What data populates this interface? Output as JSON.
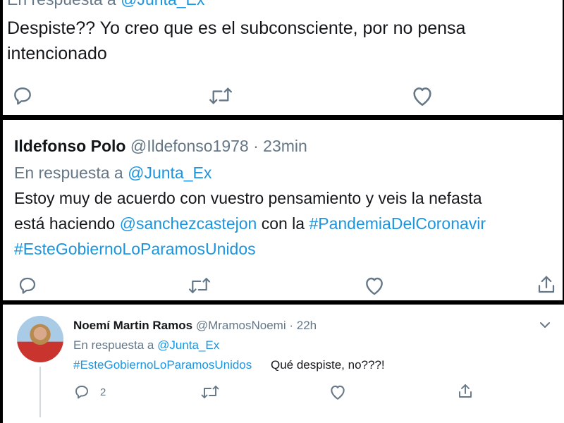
{
  "tweet1": {
    "reply_prefix": "En respuesta a",
    "reply_handle": "@Junta_Ex",
    "text_line1": "Despiste?? Yo creo que es el subconsciente, por no pensa",
    "text_line2": "intencionado"
  },
  "tweet2": {
    "name": "Ildefonso Polo",
    "handle": "@Ildefonso1978",
    "sep": "·",
    "time": "23min",
    "reply_prefix": "En respuesta a",
    "reply_handle": "@Junta_Ex",
    "line1": "Estoy muy de acuerdo con vuestro pensamiento y veis la nefasta",
    "line2_text": "está haciendo ",
    "line2_mention": "@sanchezcastejon",
    "line2_mid": " con la ",
    "line2_hashtag": "#PandemiaDelCoronavir",
    "line3_hashtag": "#EsteGobiernoLoParamosUnidos"
  },
  "tweet3": {
    "name": "Noemí Martin Ramos",
    "handle": "@MramosNoemi",
    "sep": "·",
    "time": "22h",
    "reply_prefix": "En respuesta a",
    "reply_handle": "@Junta_Ex",
    "hashtag": "#EsteGobiernoLoParamosUnidos",
    "text": "Qué despiste, no???!",
    "reply_count": "2"
  },
  "icons": [
    "reply-icon",
    "retweet-icon",
    "like-icon",
    "share-icon",
    "chevron-down-icon"
  ],
  "colors": {
    "link": "#1b95e0",
    "muted": "#657786",
    "text": "#14171a",
    "icon": "#657786"
  }
}
